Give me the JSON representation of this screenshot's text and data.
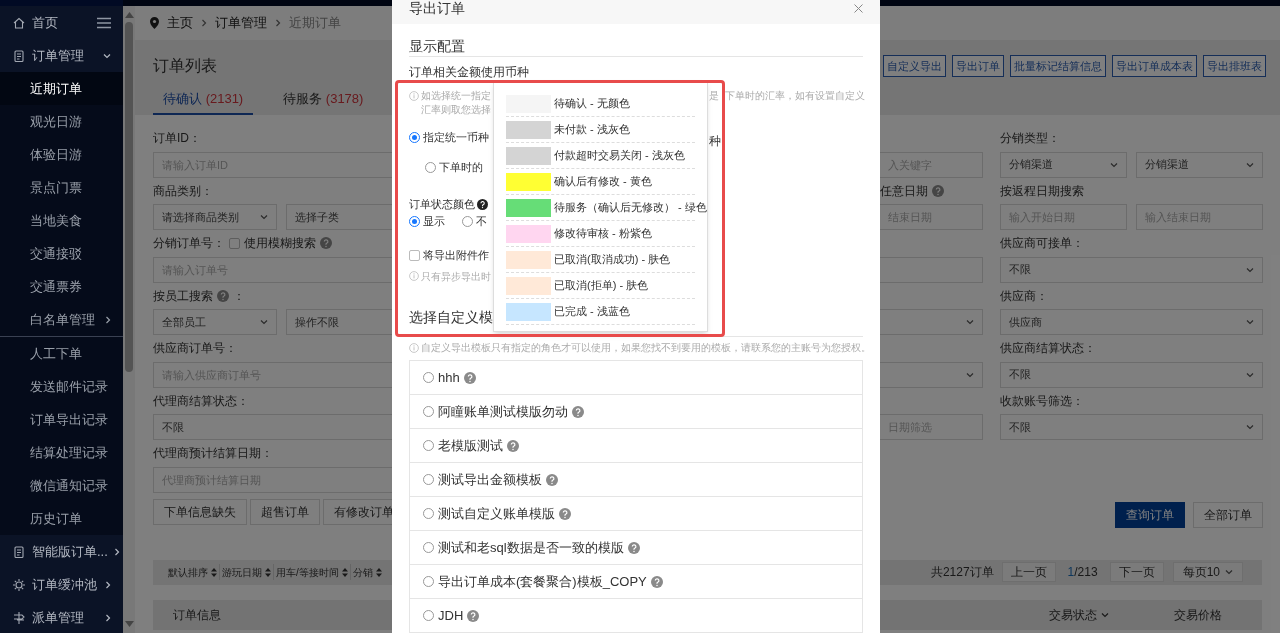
{
  "sidebar": {
    "items": [
      {
        "label": "首页",
        "kind": "link"
      },
      {
        "label": "订单管理",
        "kind": "menu",
        "expanded": true,
        "child_groups": [
          [
            {
              "label": "近期订单",
              "kind": "link",
              "selected": true
            },
            {
              "label": "观光日游",
              "kind": "link",
              "selected": false
            },
            {
              "label": "体验日游",
              "kind": "link",
              "selected": false
            },
            {
              "label": "景点门票",
              "kind": "link",
              "selected": false
            },
            {
              "label": "当地美食",
              "kind": "link",
              "selected": false
            },
            {
              "label": "交通接驳",
              "kind": "link",
              "selected": false
            },
            {
              "label": "交通票券",
              "kind": "link",
              "selected": false
            },
            {
              "label": "白名单管理",
              "kind": "menu",
              "expanded": false,
              "selected": false
            }
          ],
          [
            {
              "label": "人工下单",
              "kind": "link",
              "selected": false
            },
            {
              "label": "发送邮件记录",
              "kind": "link",
              "selected": false
            },
            {
              "label": "订单导出记录",
              "kind": "link",
              "selected": false
            },
            {
              "label": "结算处理记录",
              "kind": "link",
              "selected": false
            },
            {
              "label": "微信通知记录",
              "kind": "link",
              "selected": false
            },
            {
              "label": "历史订单",
              "kind": "link",
              "selected": false
            }
          ]
        ]
      },
      {
        "label": "智能版订单...",
        "kind": "menu",
        "expanded": false
      },
      {
        "label": "订单缓冲池",
        "kind": "menu",
        "expanded": false
      },
      {
        "label": "派单管理",
        "kind": "menu",
        "expanded": false
      }
    ]
  },
  "breadcrumb": [
    "主页",
    "订单管理",
    "近期订单"
  ],
  "page": {
    "title": "订单列表",
    "tabs": [
      {
        "label": "待确认",
        "count": "(2131)",
        "selected": true
      },
      {
        "label": "待服务",
        "count": "(3178)",
        "selected": false
      }
    ],
    "actions": [
      "自定义导出",
      "导出订单",
      "批量标记结算信息",
      "导出订单成本表",
      "导出排班表"
    ]
  },
  "filters": {
    "left": [
      {
        "label": "订单ID：",
        "fields": [
          {
            "kind": "input",
            "placeholder": "请输入订单ID"
          }
        ]
      },
      {
        "label": "商品类别：",
        "fields": [
          {
            "kind": "select",
            "value": "请选择商品类别"
          },
          {
            "kind": "box",
            "value": "选择子类"
          }
        ]
      },
      {
        "label": "分销订单号：",
        "checkbox": {
          "label": "使用模糊搜索",
          "checked": false,
          "help": true
        },
        "fields": [
          {
            "kind": "input",
            "placeholder": "请输入订单号"
          }
        ]
      },
      {
        "label": "按员工搜索",
        "help": true,
        "label_tail": "：",
        "fields": [
          {
            "kind": "select",
            "value": "全部员工"
          },
          {
            "kind": "box",
            "value": "操作不限"
          }
        ]
      },
      {
        "label": "供应商订单号：",
        "fields": [
          {
            "kind": "input",
            "placeholder": "请输入供应商订单号"
          }
        ]
      },
      {
        "label": "代理商结算状态：",
        "fields": [
          {
            "kind": "box",
            "value": "不限"
          }
        ]
      },
      {
        "label": "代理商预计结算日期：",
        "fields": [
          {
            "kind": "input",
            "placeholder": "代理商预计结算日期"
          }
        ]
      }
    ],
    "middle": [
      {
        "fields": [
          {
            "kind": "input",
            "placeholder": "入关键字"
          }
        ]
      },
      {
        "label": "任意日期",
        "help": true,
        "fields": [
          {
            "kind": "input",
            "placeholder": "结束日期"
          }
        ]
      },
      {
        "fields": [
          {
            "kind": "input"
          }
        ]
      },
      {
        "fields": [
          {
            "kind": "select"
          }
        ]
      },
      {
        "fields": [
          {
            "kind": "select"
          }
        ]
      },
      {
        "fields": [
          {
            "kind": "input",
            "placeholder": "日期筛选"
          }
        ]
      }
    ],
    "right": [
      {
        "label": "分销类型：",
        "fields": [
          {
            "kind": "select",
            "value": "分销渠道"
          },
          {
            "kind": "select",
            "value": "分销渠道"
          }
        ]
      },
      {
        "label": "按返程日期搜索",
        "fields": [
          {
            "kind": "input",
            "placeholder": "输入开始日期"
          },
          {
            "kind": "input",
            "placeholder": "输入结束日期"
          }
        ]
      },
      {
        "label": "供应商可接单：",
        "fields": [
          {
            "kind": "select",
            "value": "不限"
          }
        ]
      },
      {
        "label": "供应商：",
        "fields": [
          {
            "kind": "select",
            "value": "供应商"
          }
        ]
      },
      {
        "label": "供应商结算状态：",
        "fields": [
          {
            "kind": "select",
            "value": "不限"
          }
        ]
      },
      {
        "label": "收款账号筛选：",
        "fields": [
          {
            "kind": "select",
            "value": "不限"
          }
        ]
      }
    ]
  },
  "quick_filters": [
    "下单信息缺失",
    "超售订单",
    "有修改订单"
  ],
  "query_buttons": [
    {
      "label": "查询订单",
      "primary": true
    },
    {
      "label": "全部订单",
      "primary": false
    }
  ],
  "sort_options": [
    "默认排序",
    "游玩日期",
    "用车/等接时间",
    "分销"
  ],
  "pagination": {
    "total": "共2127订单",
    "prev": "上一页",
    "current": "1",
    "pages": "/213",
    "next": "下一页",
    "page_size": "每页10"
  },
  "table_columns": [
    {
      "label": "订单信息",
      "sortable": false
    },
    {
      "label": "交易状态",
      "sortable": true
    },
    {
      "label": "交易价格",
      "sortable": false
    }
  ],
  "modal": {
    "title": "导出订单",
    "display_title": "显示配置",
    "currency_label": "订单相关金额使用币种",
    "currency_hint_left": [
      "如选择统一指定",
      "汇率则取您选择"
    ],
    "currency_hint_right": [
      "是",
      "下单时的汇率，如有设置自定义"
    ],
    "currency_options": [
      {
        "label": "指定统一币种",
        "selected": true
      },
      {
        "label": "下单时的",
        "selected": false
      }
    ],
    "currency_right_fragment": "种",
    "status_color_label": "订单状态颜色",
    "status_color_options": [
      {
        "label": "显示",
        "selected": true
      },
      {
        "label": "不",
        "selected": false
      }
    ],
    "attachment": {
      "label": "将导出附件作",
      "checked": false
    },
    "attachment_hint": "只有异步导出时",
    "color_legend": [
      {
        "label": "待确认 - 无颜色",
        "color": "#f5f5f5"
      },
      {
        "label": "未付款 - 浅灰色",
        "color": "#d4d4d4"
      },
      {
        "label": "付款超时交易关闭 - 浅灰色",
        "color": "#d4d4d4"
      },
      {
        "label": "确认后有修改 - 黄色",
        "color": "#ffff33"
      },
      {
        "label": "待服务（确认后无修改） - 绿色",
        "color": "#66dd77"
      },
      {
        "label": "修改待审核 - 粉紫色",
        "color": "#ffd6f0"
      },
      {
        "label": "已取消(取消成功) - 肤色",
        "color": "#ffe9d8"
      },
      {
        "label": "已取消(拒单) - 肤色",
        "color": "#ffe9d8"
      },
      {
        "label": "已完成 - 浅蓝色",
        "color": "#c6e6ff"
      }
    ],
    "templates_title": "选择自定义模",
    "templates_hint": "自定义导出模板只有指定的角色才可以使用，如果您找不到要用的模板，请联系您的主账号为您授权。",
    "templates": [
      {
        "label": "hhh",
        "selected": false
      },
      {
        "label": "阿瞳账单测试模版勿动",
        "selected": false
      },
      {
        "label": "老模版测试",
        "selected": false
      },
      {
        "label": "测试导出金额模板",
        "selected": false
      },
      {
        "label": "测试自定义账单模版",
        "selected": false
      },
      {
        "label": "测试和老sql数据是否一致的模版",
        "selected": false
      },
      {
        "label": "导出订单成本(套餐聚合)模板_COPY",
        "selected": false
      },
      {
        "label": "JDH",
        "selected": false
      }
    ]
  }
}
